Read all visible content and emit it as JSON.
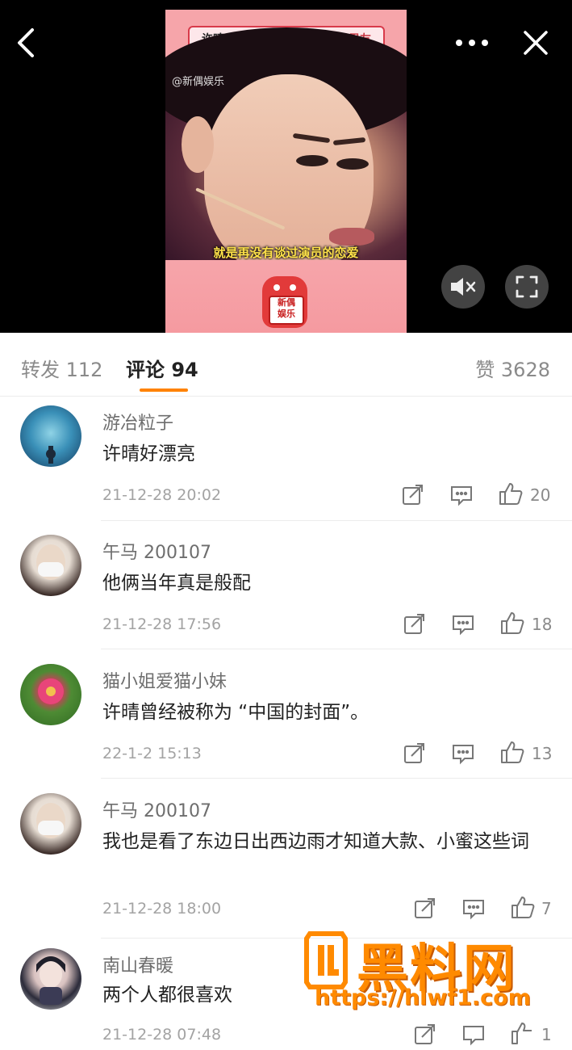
{
  "colors": {
    "accent": "#ff8200",
    "video_bg": "#000000",
    "muted_text": "#8a8a8a"
  },
  "video": {
    "caption_prefix": "许晴：",
    "caption_main": "志文是我最后一个演员男友",
    "source_watermark": "@新偶娱乐",
    "subtitle": "就是再没有谈过演员的恋爱",
    "mascot_text_line1": "新偶",
    "mascot_text_line2": "娱乐",
    "icons": {
      "back": "back-arrow-icon",
      "more": "more-dots-icon",
      "close": "close-icon",
      "mute": "mute-speaker-icon",
      "fullscreen": "fullscreen-icon"
    }
  },
  "tabs": {
    "repost": "转发 112",
    "comments": "评论 94",
    "likes": "赞 3628",
    "active": "comments"
  },
  "comments": [
    {
      "user": "游冶粒子",
      "text": "许晴好漂亮",
      "time": "21-12-28 20:02",
      "likes": "20",
      "avatar": "ocean-avatar"
    },
    {
      "user": "午马 200107",
      "text": "他俩当年真是般配",
      "time": "21-12-28 17:56",
      "likes": "18",
      "avatar": "masked-woman-avatar"
    },
    {
      "user": "猫小姐爱猫小妹",
      "text": "许晴曾经被称为 “中国的封面”。",
      "time": "22-1-2 15:13",
      "likes": "13",
      "avatar": "flower-avatar"
    },
    {
      "user": "午马 200107",
      "text": "我也是看了东边日出西边雨才知道大款、小蜜这些词",
      "time": "21-12-28 18:00",
      "likes": "7",
      "avatar": "masked-woman-avatar"
    },
    {
      "user": "南山春暖",
      "text": "两个人都很喜欢",
      "time": "21-12-28 07:48",
      "likes": "1",
      "avatar": "anime-avatar"
    }
  ],
  "watermark": {
    "title": "黑料网",
    "url": "https://hlwf1.com"
  }
}
